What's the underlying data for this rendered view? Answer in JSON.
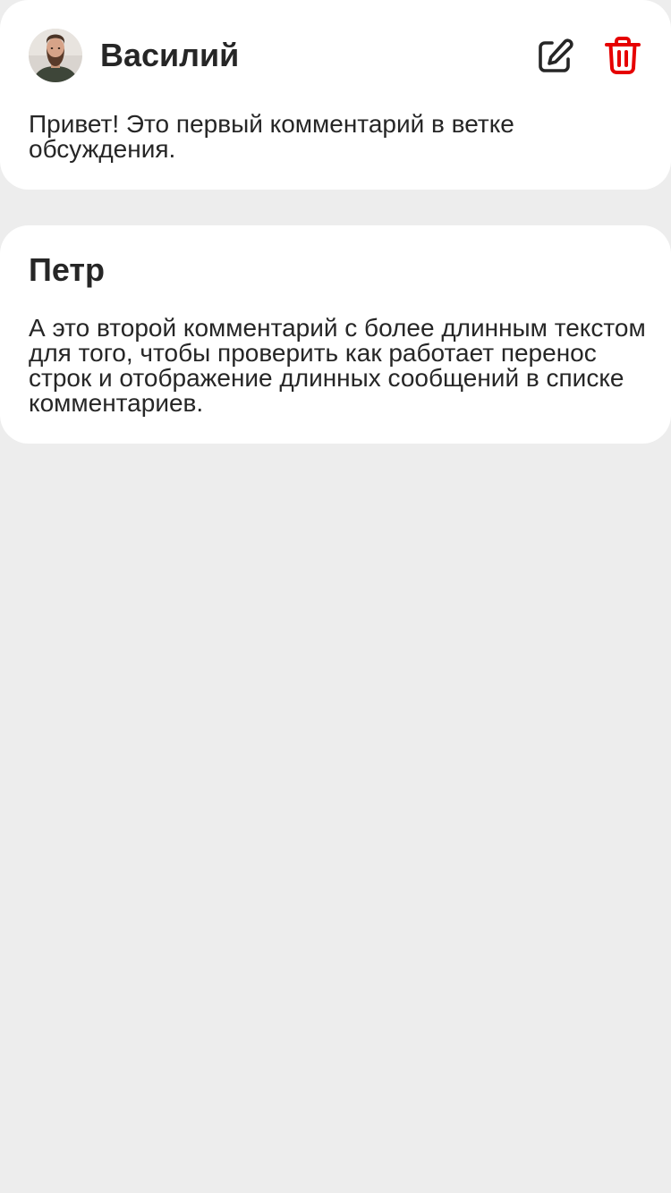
{
  "comments": [
    {
      "author": "Василий",
      "has_avatar": true,
      "avatar_icon": "bearded-man-avatar",
      "text": "Привет! Это первый комментарий в ветке обсуждения.",
      "actions": [
        {
          "name": "edit",
          "icon": "pencil-square-icon",
          "color": "#262626"
        },
        {
          "name": "delete",
          "icon": "trash-icon",
          "color": "#e60000"
        }
      ]
    },
    {
      "author": "Петр",
      "has_avatar": false,
      "text": "А это второй комментарий с более длинным текстом для того, чтобы проверить как работает перенос строк и отображение длинных сообщений в списке комментариев."
    }
  ],
  "colors": {
    "background": "#ededed",
    "card": "#ffffff",
    "text": "#262626",
    "danger": "#e60000"
  }
}
